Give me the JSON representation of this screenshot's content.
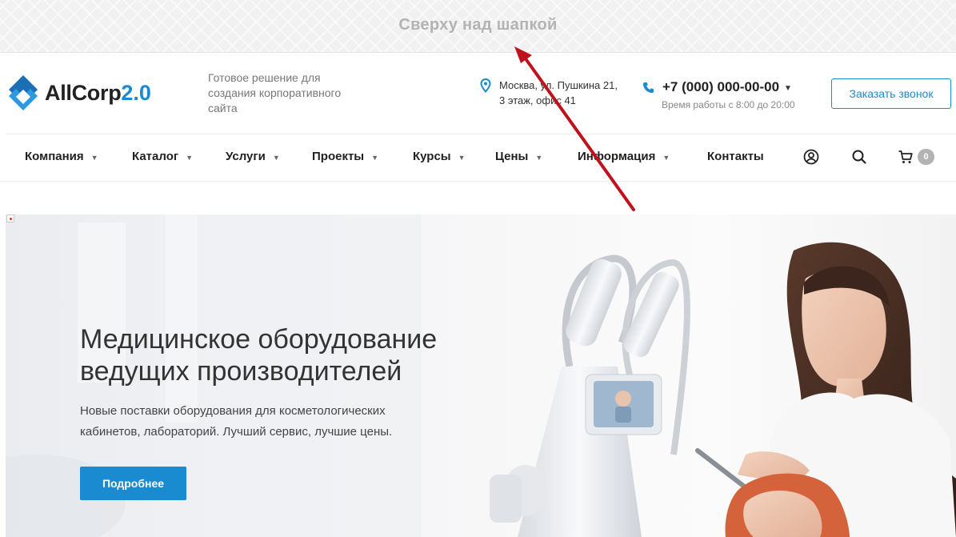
{
  "top_banner": {
    "text": "Сверху над шапкой"
  },
  "header": {
    "logo": {
      "name": "AllCorp",
      "version": "2.0"
    },
    "tagline": "Готовое решение для создания корпоративного сайта",
    "address": "Москва, ул. Пушкина 21, 3 этаж, офис 41",
    "phone": "+7 (000) 000-00-00",
    "hours": "Время работы с 8:00 до 20:00",
    "callback_label": "Заказать звонок"
  },
  "nav": {
    "items": [
      {
        "label": "Компания",
        "has_dropdown": true
      },
      {
        "label": "Каталог",
        "has_dropdown": true
      },
      {
        "label": "Услуги",
        "has_dropdown": true
      },
      {
        "label": "Проекты",
        "has_dropdown": true
      },
      {
        "label": "Курсы",
        "has_dropdown": true
      },
      {
        "label": "Цены",
        "has_dropdown": true
      },
      {
        "label": "Информация",
        "has_dropdown": true
      },
      {
        "label": "Контакты",
        "has_dropdown": false
      }
    ],
    "icons": [
      "user-icon",
      "search-icon",
      "cart-icon"
    ],
    "cart_count": "0"
  },
  "hero": {
    "title": "Медицинское оборудование ведущих производителей",
    "text": "Новые поставки оборудования для косметологических кабинетов, лабораторий. Лучший сервис, лучшие цены.",
    "button_label": "Подробнее"
  },
  "colors": {
    "accent": "#1a8ad1",
    "annotation_arrow": "#c0121b",
    "banner_text": "#b3b3b3"
  }
}
